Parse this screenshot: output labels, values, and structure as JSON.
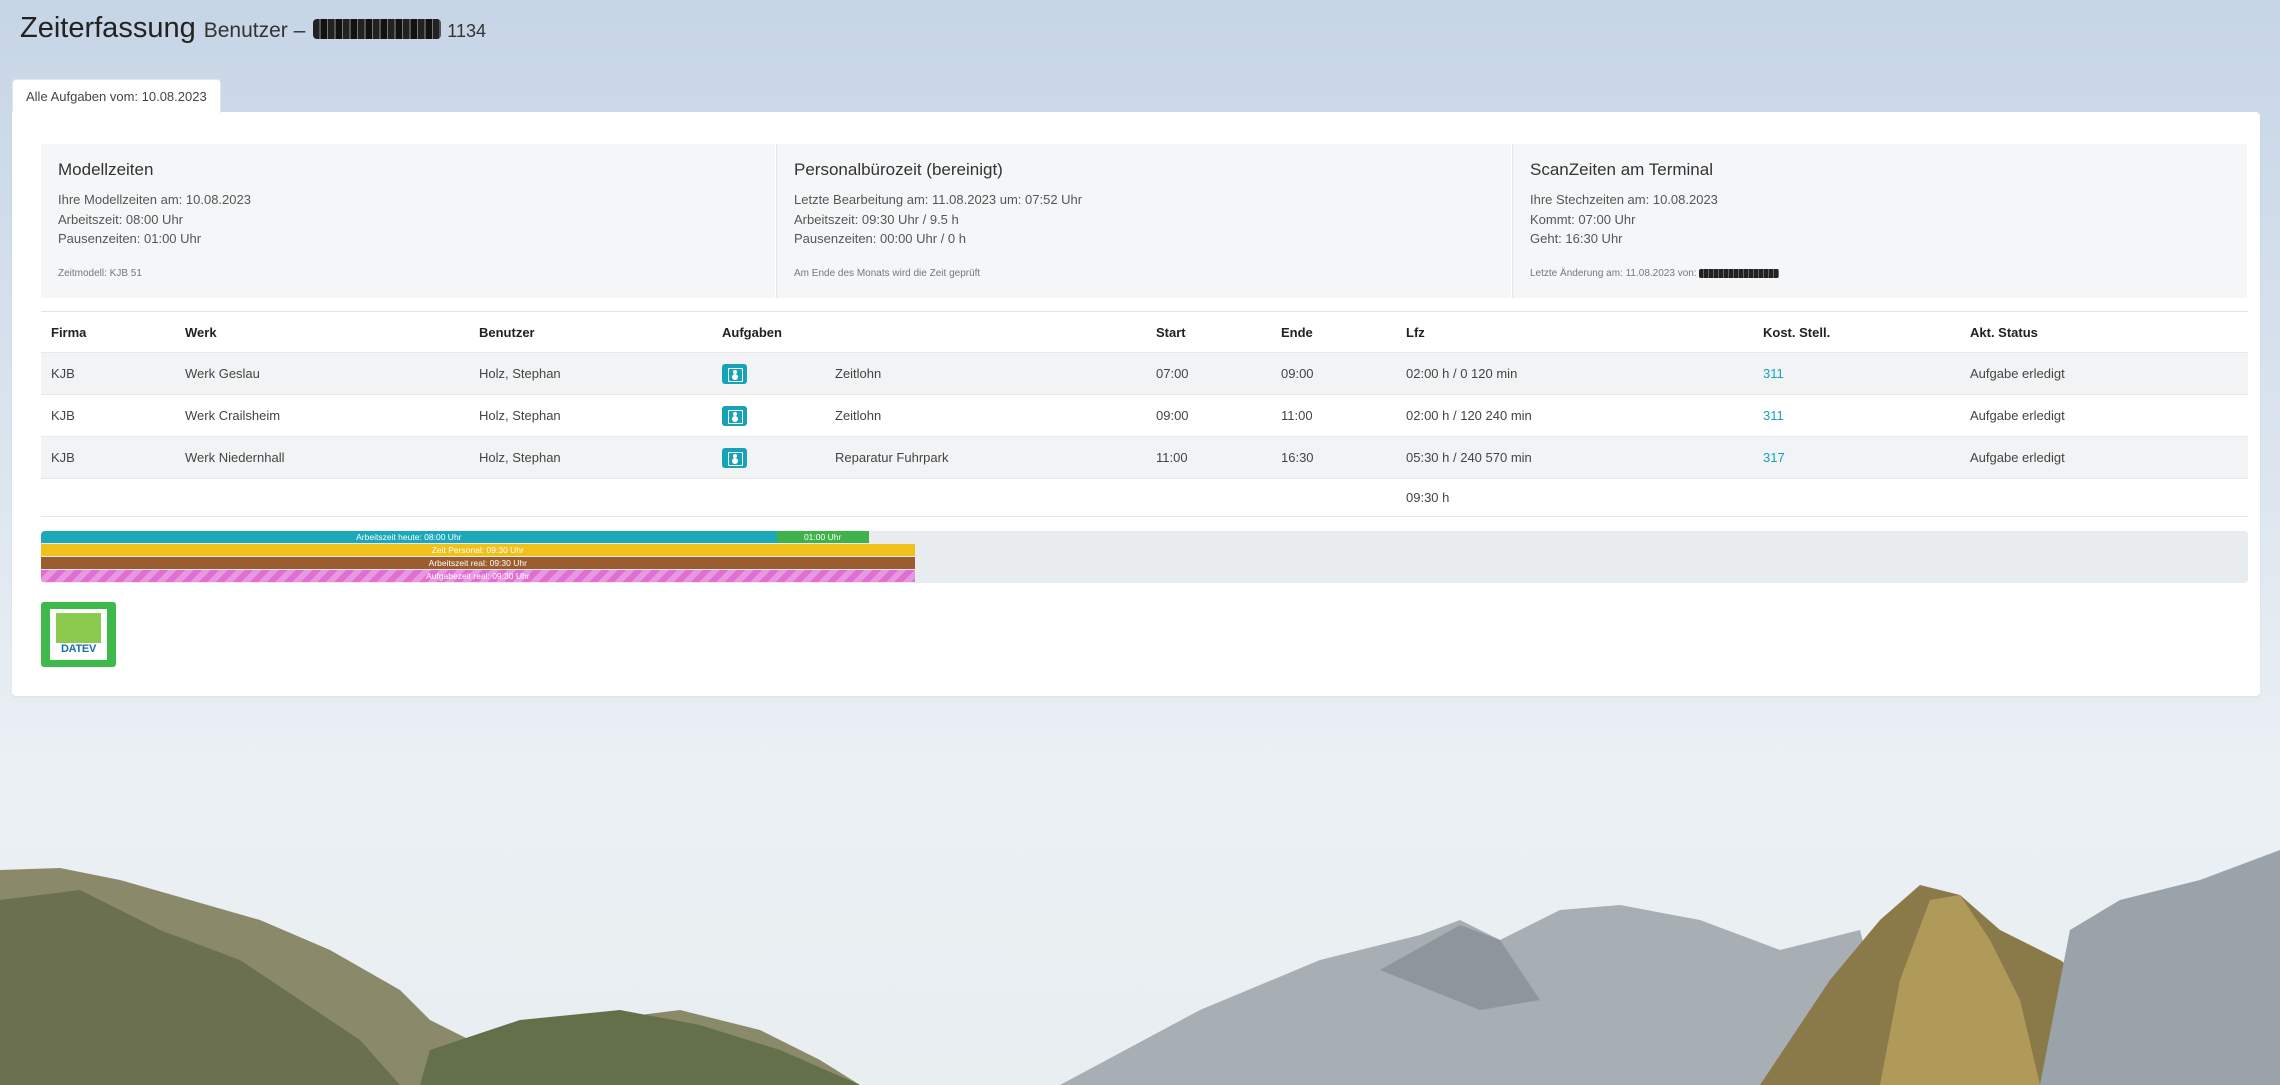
{
  "header": {
    "title": "Zeiterfassung",
    "user_label": "Benutzer –",
    "user_id": "1134"
  },
  "tab": {
    "label": "Alle Aufgaben vom: 10.08.2023"
  },
  "cards": [
    {
      "title": "Modellzeiten",
      "lines": [
        "Ihre Modellzeiten am: 10.08.2023",
        "Arbeitszeit: 08:00 Uhr",
        "Pausenzeiten: 01:00 Uhr"
      ],
      "foot": "Zeitmodell: KJB 51"
    },
    {
      "title": "Personalbürozeit (bereinigt)",
      "lines": [
        "Letzte Bearbeitung am: 11.08.2023 um: 07:52 Uhr",
        "Arbeitszeit: 09:30 Uhr / 9.5 h",
        "Pausenzeiten: 00:00 Uhr / 0 h"
      ],
      "foot": "Am Ende des Monats wird die Zeit geprüft"
    },
    {
      "title": "ScanZeiten am Terminal",
      "lines": [
        "Ihre Stechzeiten am: 10.08.2023",
        "Kommt: 07:00 Uhr",
        "Geht: 16:30 Uhr"
      ],
      "foot": "Letzte Änderung am: 11.08.2023 von:"
    }
  ],
  "table": {
    "headers": [
      "Firma",
      "Werk",
      "Benutzer",
      "Aufgaben",
      "",
      "Start",
      "Ende",
      "Lfz",
      "Kost. Stell.",
      "Akt. Status"
    ],
    "rows": [
      {
        "firma": "KJB",
        "werk": "Werk Geslau",
        "benutzer": "Holz, Stephan",
        "aufgabe": "Zeitlohn",
        "start": "07:00",
        "ende": "09:00",
        "lfz": "02:00 h / 0 120 min",
        "kost": "311",
        "status": "Aufgabe erledigt"
      },
      {
        "firma": "KJB",
        "werk": "Werk Crailsheim",
        "benutzer": "Holz, Stephan",
        "aufgabe": "Zeitlohn",
        "start": "09:00",
        "ende": "11:00",
        "lfz": "02:00 h / 120 240 min",
        "kost": "311",
        "status": "Aufgabe erledigt"
      },
      {
        "firma": "KJB",
        "werk": "Werk Niedernhall",
        "benutzer": "Holz, Stephan",
        "aufgabe": "Reparatur Fuhrpark",
        "start": "11:00",
        "ende": "16:30",
        "lfz": "05:30 h / 240 570 min",
        "kost": "317",
        "status": "Aufgabe erledigt"
      }
    ],
    "total": "09:30 h",
    "icon": "user-badge-icon"
  },
  "bars": {
    "scale_max_hours": 24,
    "rows": [
      {
        "segments": [
          {
            "label": "Arbeitszeit heute: 08:00 Uhr",
            "hours": 8,
            "color": "#1ba9ba"
          },
          {
            "label": "01:00 Uhr",
            "hours": 1,
            "color": "#3fb34a"
          }
        ]
      },
      {
        "segments": [
          {
            "label": "Zeit Personal: 09:30 Uhr",
            "hours": 9.5,
            "color": "#f0c01c"
          }
        ]
      },
      {
        "segments": [
          {
            "label": "Arbeitszeit real: 09:30 Uhr",
            "hours": 9.5,
            "color": "#9c5c2c"
          }
        ]
      },
      {
        "segments": [
          {
            "label": "Aufgabezeit real: 09:30 Uhr",
            "hours": 9.5,
            "color": "#e06fd4"
          }
        ]
      }
    ]
  },
  "datev": {
    "label": "DATEV"
  }
}
